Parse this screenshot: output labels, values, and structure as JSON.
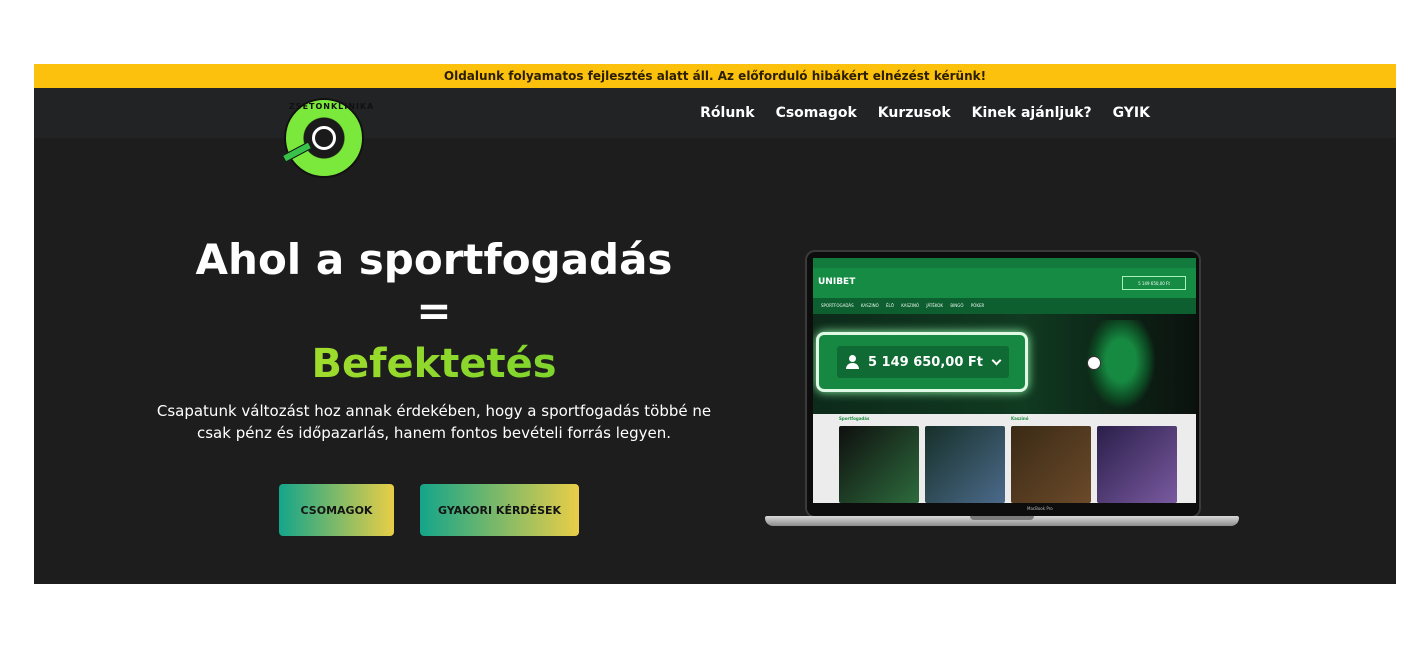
{
  "notice": "Oldalunk folyamatos fejlesztés alatt áll. Az előforduló hibákért elnézést kérünk!",
  "logo": {
    "text": "ZSETONKLINIKA",
    "icon": "poker-chip-logo"
  },
  "nav": {
    "items": [
      {
        "label": "Rólunk"
      },
      {
        "label": "Csomagok"
      },
      {
        "label": "Kurzusok"
      },
      {
        "label": "Kinek ajánljuk?"
      },
      {
        "label": "GYIK"
      }
    ]
  },
  "hero": {
    "title": "Ahol a sportfogadás",
    "equals": "=",
    "highlight": "Befektetés",
    "subtitle": "Csapatunk változást hoz annak érdekében, hogy a sportfogadás többé ne csak pénz és időpazarlás, hanem fontos bevételi forrás legyen.",
    "buttons": {
      "packages": "CSOMAGOK",
      "faq": "GYAKORI KÉRDÉSEK"
    }
  },
  "mockup": {
    "brand": "UNIBET",
    "balance": "5 149 650,00 Ft",
    "account_small": "5 149 650,00 Ft",
    "menu": "SPORTFOGADÁS KASZINÓ ÉLŐ KASZINÓ JÁTÉKOK BINGÓ PÓKER",
    "section_sport": "Sportfogadás",
    "section_casino": "Kaszinó",
    "device_label": "MacBook Pro"
  },
  "colors": {
    "banner": "#fcc10c",
    "navbar": "#222325",
    "hero_bg": "#1d1d1d",
    "accent_green": "#6ed12b",
    "button_from": "#14a58a",
    "button_to": "#e9ce47"
  }
}
